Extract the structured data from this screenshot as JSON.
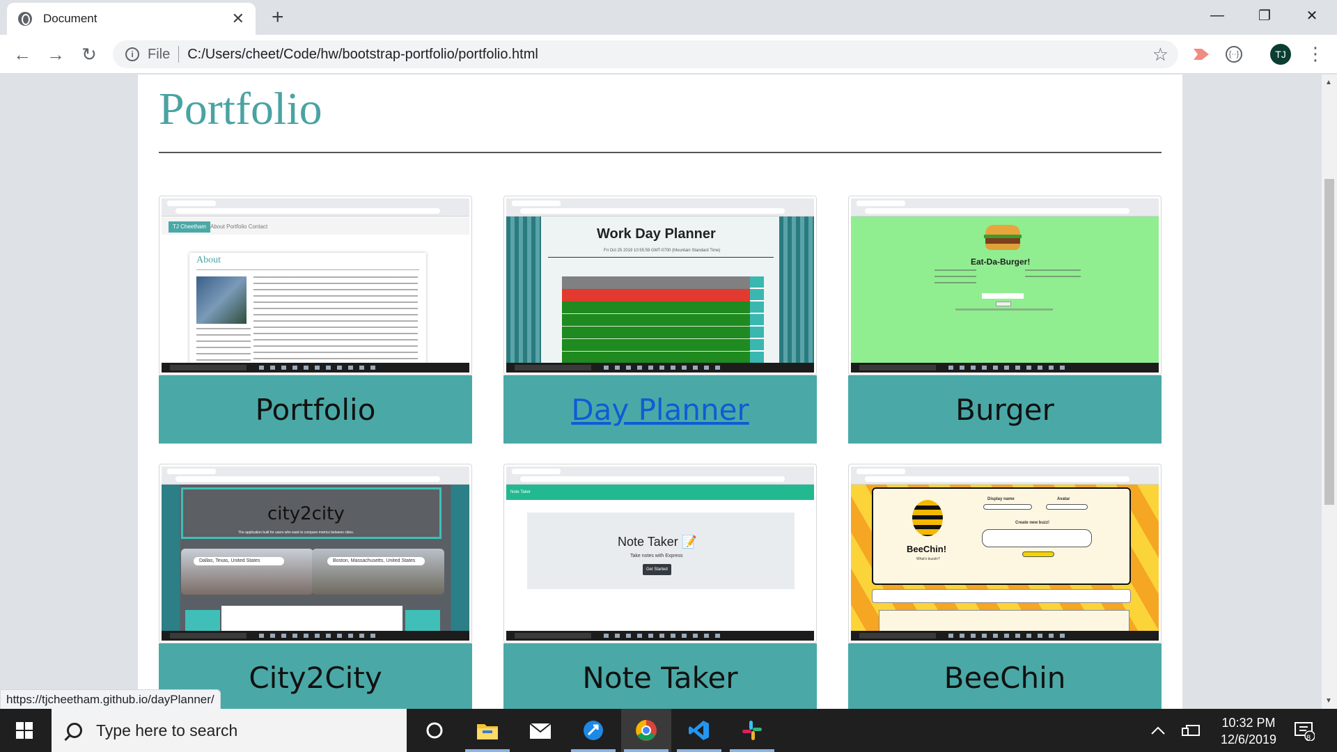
{
  "browser": {
    "tab_title": "Document",
    "tab_close": "✕",
    "new_tab": "+",
    "window_controls": {
      "minimize": "—",
      "restore": "❐",
      "close": "✕"
    },
    "nav": {
      "back": "←",
      "forward": "→",
      "reload": "↻"
    },
    "address": {
      "scheme": "File",
      "url": "C:/Users/cheet/Code/hw/bootstrap-portfolio/portfolio.html"
    },
    "star": "☆",
    "profile_initials": "TJ",
    "menu": "⋮",
    "ext_label": "{··}"
  },
  "page": {
    "title": "Portfolio",
    "projects": [
      {
        "label": "Portfolio",
        "is_link": false
      },
      {
        "label": "Day Planner",
        "is_link": true
      },
      {
        "label": "Burger",
        "is_link": false
      },
      {
        "label": "City2City",
        "is_link": false
      },
      {
        "label": "Note Taker",
        "is_link": false
      },
      {
        "label": "BeeChin",
        "is_link": false
      }
    ],
    "thumbnails": {
      "portfolio": {
        "brand": "TJ Cheetham",
        "nav": "About  Portfolio  Contact",
        "heading": "About"
      },
      "day_planner": {
        "heading": "Work Day Planner",
        "date": "Fri Oct 25 2019 10:55:59 GMT-0700 (Mountain Standard Time)"
      },
      "burger": {
        "heading": "Eat-Da-Burger!"
      },
      "city2city": {
        "heading": "city2city",
        "sub": "The application built for users who want to compare metrics between cities.",
        "from": "Dallas, Texas, United States",
        "to": "Boston, Massachusetts, United States"
      },
      "note_taker": {
        "bar": "Note Taker",
        "heading": "Note Taker 📝",
        "sub": "Take notes with Express",
        "button": "Get Started"
      },
      "beechin": {
        "heading": "BeeChin!",
        "sub": "What's buzzin?",
        "display_name": "Display name",
        "avatar": "Avatar",
        "create": "Create new buzz!"
      }
    }
  },
  "status_bar_url": "https://tjcheetham.github.io/dayPlanner/",
  "taskbar": {
    "search_placeholder": "Type here to search",
    "time": "10:32 PM",
    "date": "12/6/2019",
    "notification_count": "8"
  }
}
